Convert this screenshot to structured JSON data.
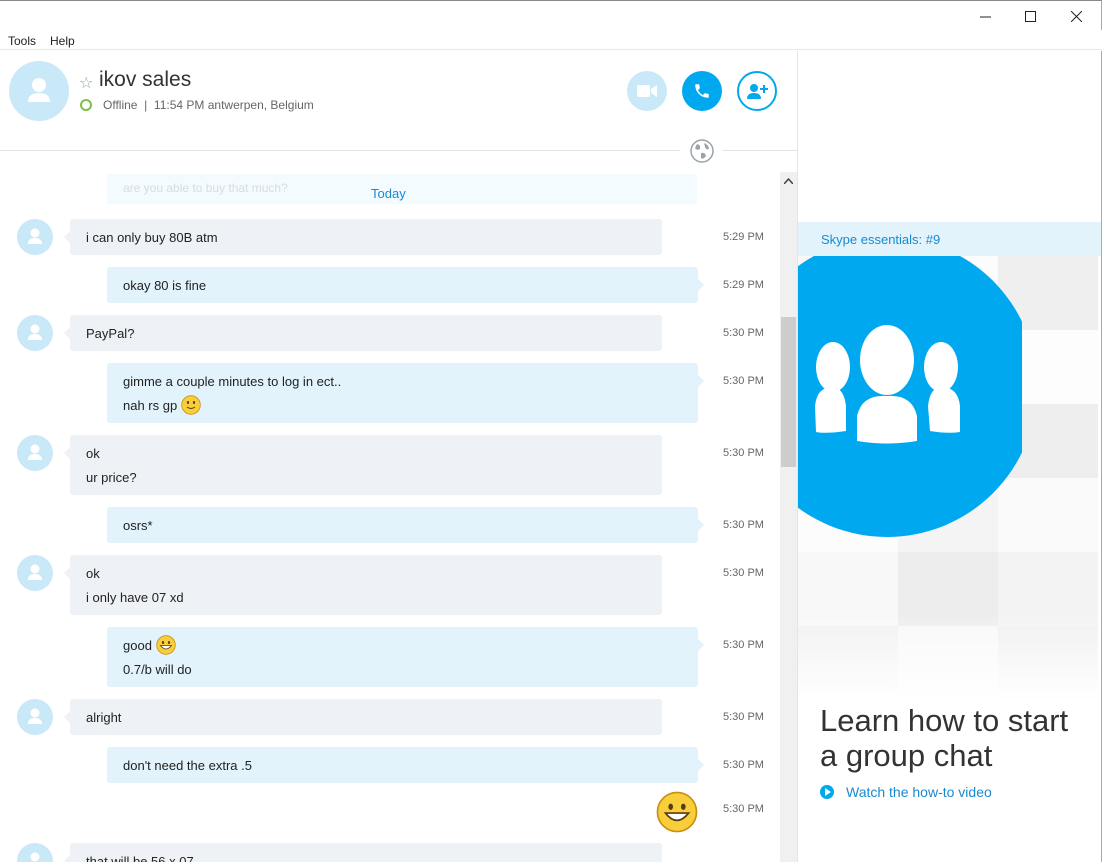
{
  "window": {
    "minimize_glyph": "—",
    "maximize_glyph": "☐",
    "close_glyph": "✕"
  },
  "menu": {
    "tools": "Tools",
    "help": "Help"
  },
  "contact": {
    "name": "ikov sales",
    "status": "Offline",
    "local_time": "11:54 PM antwerpen, Belgium",
    "status_line": "Offline  |  11:54 PM antwerpen, Belgium"
  },
  "chat": {
    "faded_message": "are you able to buy that much?",
    "day_separator": "Today",
    "messages": [
      {
        "dir": "in",
        "lines": [
          "i can only buy 80B atm"
        ],
        "time": "5:29 PM"
      },
      {
        "dir": "out",
        "lines": [
          "okay 80 is fine"
        ],
        "time": "5:29 PM"
      },
      {
        "dir": "in",
        "lines": [
          "PayPal?"
        ],
        "time": "5:30 PM"
      },
      {
        "dir": "out",
        "lines": [
          "gimme a couple minutes to log in ect..",
          "nah rs gp"
        ],
        "emoji_line": 1,
        "emoji": "smile-emoji",
        "time": "5:30 PM"
      },
      {
        "dir": "in",
        "lines": [
          "ok",
          "ur price?"
        ],
        "time": "5:30 PM"
      },
      {
        "dir": "out",
        "lines": [
          "osrs*"
        ],
        "time": "5:30 PM"
      },
      {
        "dir": "in",
        "lines": [
          "ok",
          "i only have 07 xd"
        ],
        "time": "5:30 PM"
      },
      {
        "dir": "out",
        "lines": [
          "good",
          "0.7/b will do"
        ],
        "emoji_line": 0,
        "emoji": "laugh-emoji",
        "time": "5:30 PM"
      },
      {
        "dir": "in",
        "lines": [
          "alright"
        ],
        "time": "5:30 PM"
      },
      {
        "dir": "out",
        "lines": [
          "don't need the extra .5"
        ],
        "time": "5:30 PM"
      },
      {
        "dir": "big-emoji",
        "emoji": "big-laugh-emoji",
        "time": "5:30 PM"
      },
      {
        "dir": "in",
        "lines": [
          "that will be 56 x 07"
        ],
        "time": ""
      }
    ]
  },
  "right_panel": {
    "essentials_label": "Skype essentials: #9",
    "title": "Learn how to start a group chat",
    "watch_link": "Watch the how-to video"
  },
  "icons": [
    "star-icon",
    "presence-icon",
    "video-icon",
    "phone-icon",
    "add-contact-icon",
    "globe-icon",
    "play-icon",
    "group-icon"
  ],
  "colors": {
    "accent": "#00a9ef",
    "incoming_bubble": "#eef1f5",
    "outgoing_bubble": "#e2f3fb",
    "link": "#1a8ad0"
  }
}
